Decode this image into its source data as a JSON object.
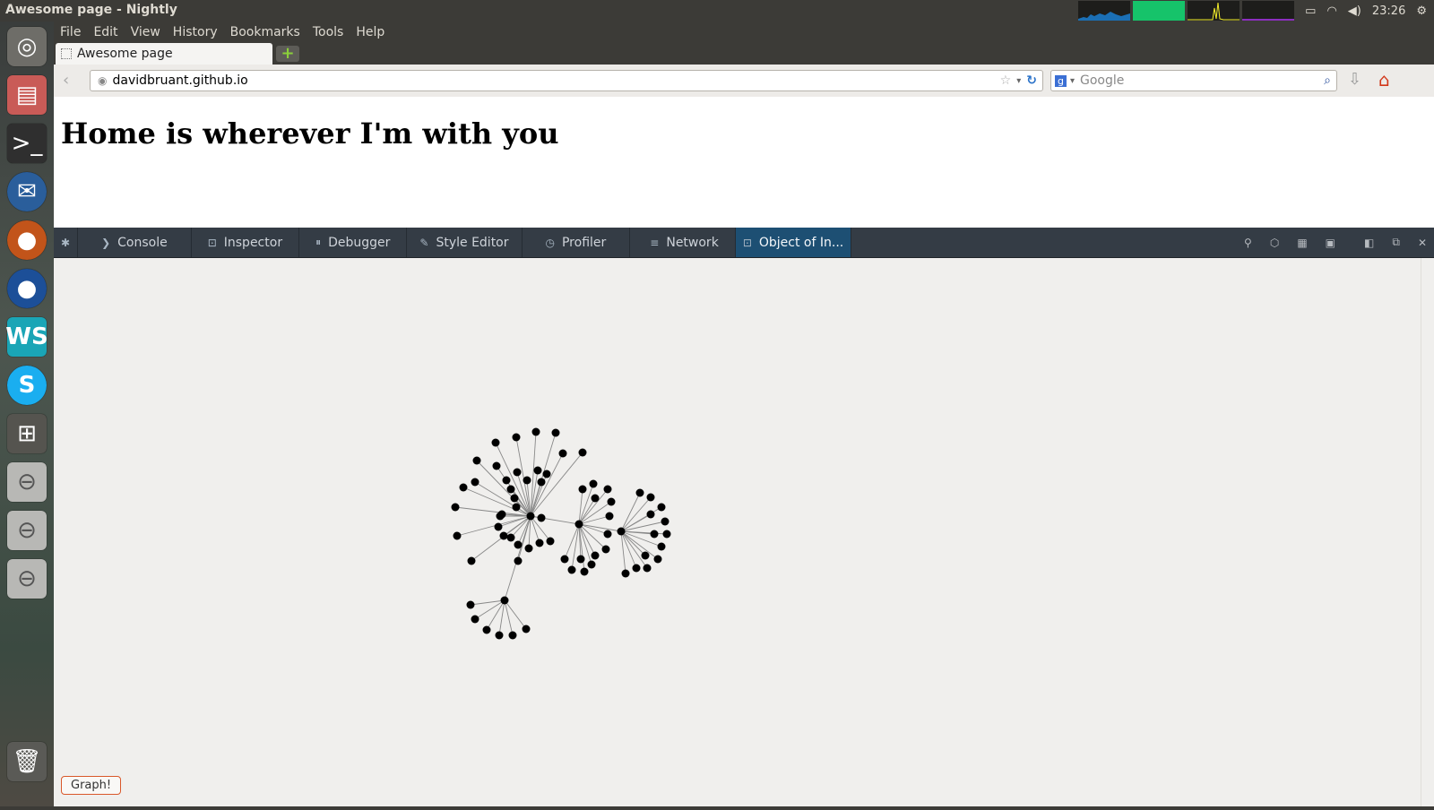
{
  "window": {
    "title": "Awesome page - Nightly"
  },
  "indicators": {
    "clock": "23:26"
  },
  "menu": [
    "File",
    "Edit",
    "View",
    "History",
    "Bookmarks",
    "Tools",
    "Help"
  ],
  "tab": {
    "title": "Awesome page"
  },
  "nav": {
    "url": "davidbruant.github.io",
    "search_placeholder": "Google"
  },
  "page": {
    "heading": "Home is wherever I'm with you"
  },
  "devtools": {
    "tabs": [
      {
        "label": "Console"
      },
      {
        "label": "Inspector"
      },
      {
        "label": "Debugger"
      },
      {
        "label": "Style Editor"
      },
      {
        "label": "Profiler"
      },
      {
        "label": "Network"
      },
      {
        "label": "Object of In..."
      }
    ],
    "graph_button": "Graph!"
  }
}
